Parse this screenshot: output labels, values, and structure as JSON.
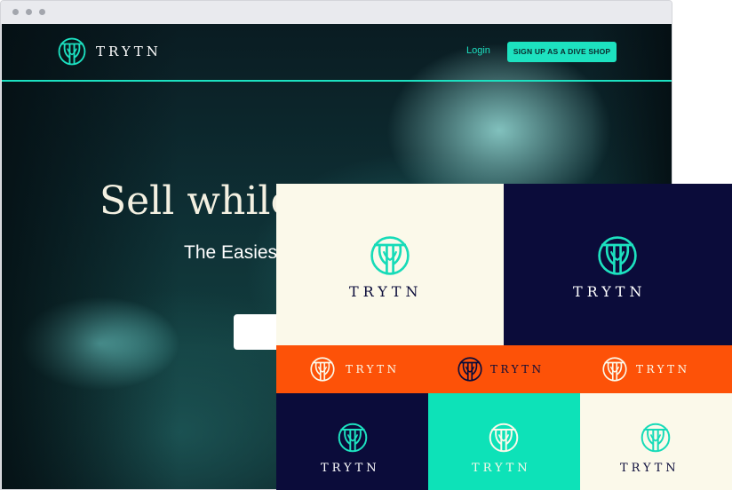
{
  "nav": {
    "wordmark": "TRYTN",
    "login": "Login",
    "cta": "SIGN UP AS A DIVE SHOP"
  },
  "hero": {
    "title": "Sell while",
    "subtitle": "The Easies"
  },
  "brand_tiles": {
    "large_cream_word": "TRYTN",
    "large_navy_word": "TRYTN",
    "orange_words": [
      "TRYTN",
      "TRYTN",
      "TRYTN"
    ],
    "small_navy_word": "TRYTN",
    "small_teal_word": "TRYTN",
    "small_cream_word": "TRYTN"
  },
  "colors": {
    "accent_teal": "#1de2c0",
    "navy": "#0b0c3a",
    "cream": "#fbf9ea",
    "orange": "#fd5208"
  },
  "icons": [
    "trytn-logo-icon"
  ]
}
